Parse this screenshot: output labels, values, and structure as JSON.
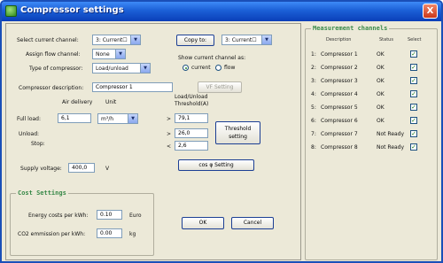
{
  "window": {
    "title": "Compressor settings",
    "close_glyph": "X"
  },
  "channel": {
    "select_label": "Select current channel:",
    "select_value": "3: Current☐",
    "copy_button": "Copy to:",
    "copy_target": "3: Current☐",
    "assign_label": "Assign flow channel:",
    "assign_value": "None",
    "type_label": "Type of compressor:",
    "type_value": "Load/unload",
    "show_label": "Show current channel as:",
    "radio_current": "current",
    "radio_flow": "flow",
    "selected_radio": "current",
    "desc_label": "Compressor description:",
    "desc_value": "Compressor 1",
    "vf_button": "VF Setting"
  },
  "load": {
    "air_delivery_header": "Air delivery",
    "unit_header": "Unit",
    "threshold_header_1": "Load/Unload",
    "threshold_header_2": "Threshold(A)",
    "full_load_label": "Full load:",
    "full_load_value": "6,1",
    "unit_value": "m³/h",
    "unload_label": "Unload:",
    "stop_label": "Stop:",
    "op_gt_1": ">",
    "op_gt_2": ">",
    "op_lt": "<",
    "threshold_full": "79,1",
    "threshold_unload": "26,0",
    "threshold_stop": "2,6",
    "threshold_button_1": "Threshold",
    "threshold_button_2": "setting",
    "supply_label": "Supply voltage:",
    "supply_value": "400,0",
    "supply_unit": "V",
    "cos_button": "cos φ Setting"
  },
  "cost": {
    "title": "Cost Settings",
    "energy_label": "Energy costs per kWh:",
    "energy_value": "0.10",
    "energy_unit": "Euro",
    "co2_label": "CO2 emmission per kWh:",
    "co2_value": "0.00",
    "co2_unit": "kg"
  },
  "actions": {
    "ok": "OK",
    "cancel": "Cancel"
  },
  "measurement": {
    "title": "Measurement channels",
    "headers": [
      "Description",
      "Status",
      "Select"
    ],
    "rows": [
      {
        "num": "1:",
        "desc": "Compressor 1",
        "status": "OK",
        "selected": true
      },
      {
        "num": "2:",
        "desc": "Compressor 2",
        "status": "OK",
        "selected": true
      },
      {
        "num": "3:",
        "desc": "Compressor 3",
        "status": "OK",
        "selected": true
      },
      {
        "num": "4:",
        "desc": "Compressor 4",
        "status": "OK",
        "selected": true
      },
      {
        "num": "5:",
        "desc": "Compressor 5",
        "status": "OK",
        "selected": true
      },
      {
        "num": "6:",
        "desc": "Compressor 6",
        "status": "OK",
        "selected": true
      },
      {
        "num": "7:",
        "desc": "Compressor 7",
        "status": "Not Ready",
        "selected": true
      },
      {
        "num": "8:",
        "desc": "Compressor 8",
        "status": "Not Ready",
        "selected": true
      }
    ],
    "check_glyph": "✓"
  }
}
